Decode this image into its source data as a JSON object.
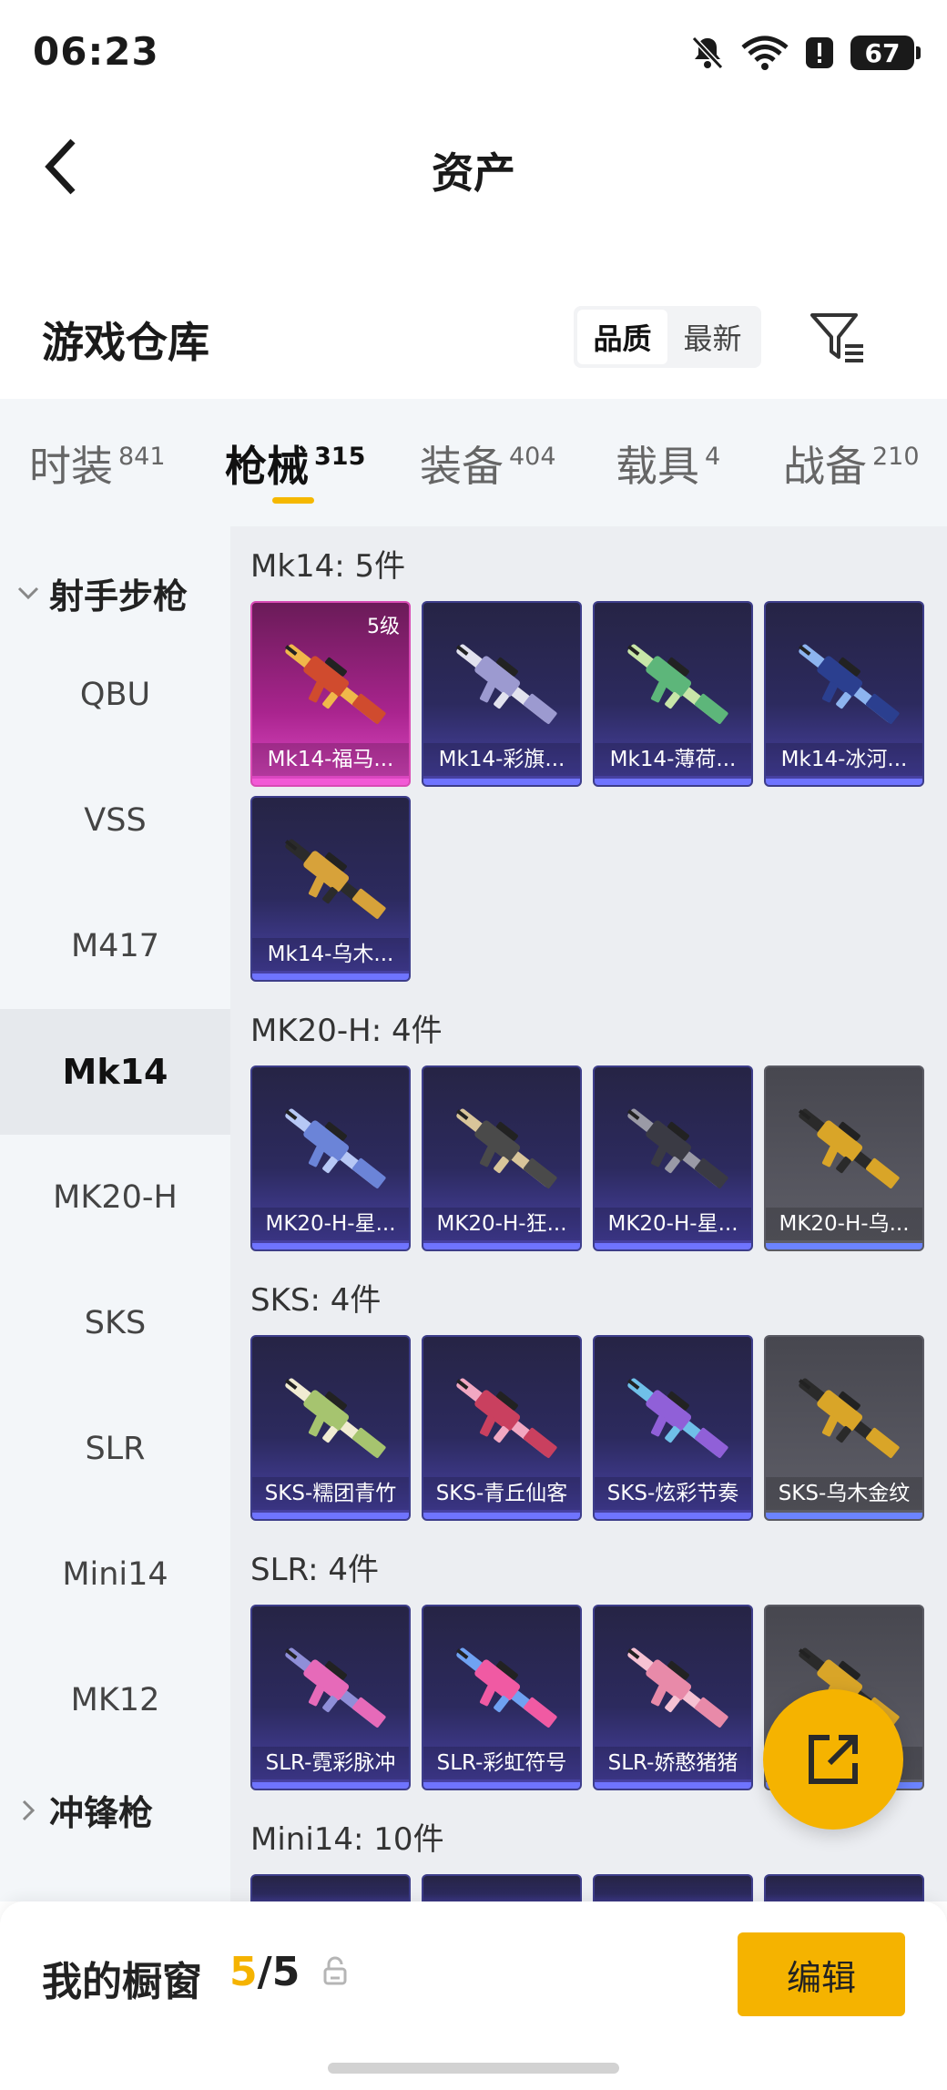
{
  "status_bar": {
    "time": "06:23",
    "battery": "67"
  },
  "header": {
    "title": "资产"
  },
  "warehouse": {
    "title": "游戏仓库",
    "sort_options": [
      "品质",
      "最新"
    ],
    "sort_selected": "品质"
  },
  "tabs": [
    {
      "label": "时装",
      "count": "841"
    },
    {
      "label": "枪械",
      "count": "315",
      "active": true
    },
    {
      "label": "装备",
      "count": "404"
    },
    {
      "label": "载具",
      "count": "4"
    },
    {
      "label": "战备",
      "count": "210"
    }
  ],
  "sidebar": {
    "group_open": "射手步枪",
    "items": [
      "QBU",
      "VSS",
      "M417",
      "Mk14",
      "MK20-H",
      "SKS",
      "SLR",
      "Mini14",
      "MK12"
    ],
    "active_item": "Mk14",
    "group_closed": "冲锋枪"
  },
  "sections": [
    {
      "title": "Mk14: 5件",
      "items": [
        {
          "name": "Mk14-福马...",
          "level": "5级",
          "style": "gold"
        },
        {
          "name": "Mk14-彩旗...",
          "style": "purple"
        },
        {
          "name": "Mk14-薄荷...",
          "style": "purple"
        },
        {
          "name": "Mk14-冰河...",
          "style": "purple"
        },
        {
          "name": "Mk14-乌木...",
          "style": "purple"
        }
      ]
    },
    {
      "title": "MK20-H: 4件",
      "items": [
        {
          "name": "MK20-H-星...",
          "style": "purple"
        },
        {
          "name": "MK20-H-狂...",
          "style": "purple"
        },
        {
          "name": "MK20-H-星...",
          "style": "purple"
        },
        {
          "name": "MK20-H-乌...",
          "style": "grey"
        }
      ]
    },
    {
      "title": "SKS: 4件",
      "items": [
        {
          "name": "SKS-糯团青竹",
          "style": "purple"
        },
        {
          "name": "SKS-青丘仙客",
          "style": "purple"
        },
        {
          "name": "SKS-炫彩节奏",
          "style": "purple"
        },
        {
          "name": "SKS-乌木金纹",
          "style": "grey"
        }
      ]
    },
    {
      "title": "SLR: 4件",
      "items": [
        {
          "name": "SLR-霓彩脉冲",
          "style": "purple"
        },
        {
          "name": "SLR-彩虹符号",
          "style": "purple"
        },
        {
          "name": "SLR-娇憨猪猪",
          "style": "purple"
        },
        {
          "name": "纹",
          "style": "grey"
        }
      ]
    },
    {
      "title": "Mini14: 10件",
      "items": []
    }
  ],
  "showcase": {
    "label": "我的橱窗",
    "current": "5",
    "separator": "/",
    "total": "5",
    "edit_label": "编辑"
  },
  "colors": {
    "accent": "#f5b300",
    "rarity_gold": "#e04ac6",
    "rarity_purple": "#4a43a8",
    "rarity_grey": "#5e5e67"
  }
}
